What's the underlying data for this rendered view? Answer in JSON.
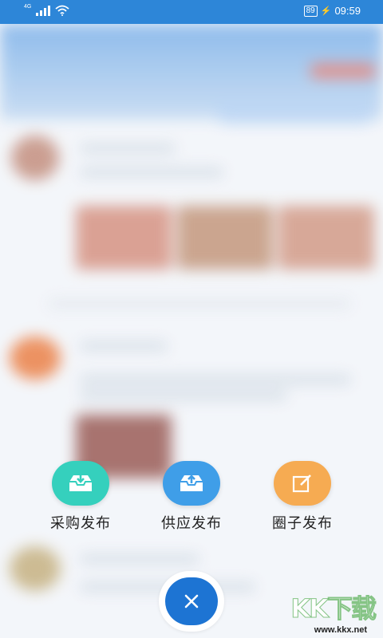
{
  "status_bar": {
    "network": "4G",
    "battery": "89",
    "time": "09:59",
    "icons": [
      "signal-icon",
      "wifi-icon",
      "charging-icon"
    ]
  },
  "publish_menu": {
    "items": [
      {
        "label": "采购发布",
        "icon": "tray-download-icon",
        "color": "#35d0bd"
      },
      {
        "label": "供应发布",
        "icon": "tray-upload-icon",
        "color": "#3f9ee8"
      },
      {
        "label": "圈子发布",
        "icon": "edit-icon",
        "color": "#f6ab52"
      }
    ],
    "close_icon": "close-icon",
    "close_color": "#1d74d3"
  },
  "watermark": {
    "brand": "KK下载",
    "url": "www.kkx.net"
  },
  "colors": {
    "status_bar": "#2d86d8",
    "label_text": "#222222"
  }
}
